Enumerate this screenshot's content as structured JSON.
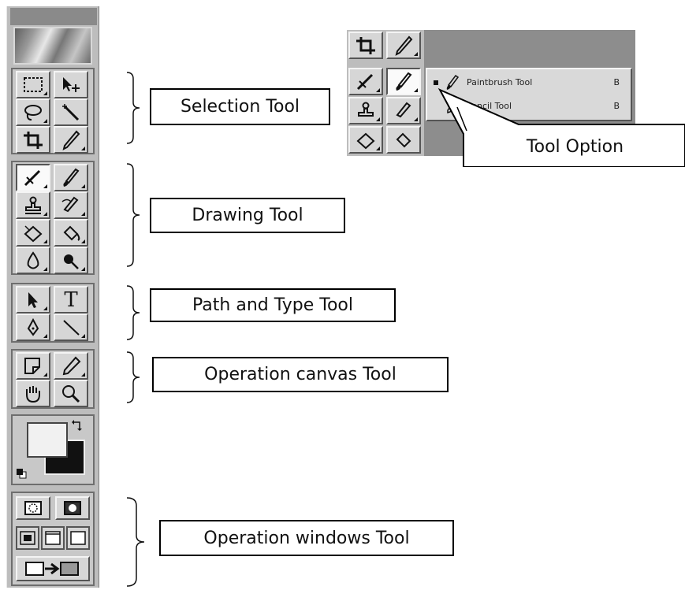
{
  "labels": {
    "selection": "Selection Tool",
    "drawing": "Drawing Tool",
    "path_type": "Path and Type Tool",
    "operation_canvas": "Operation canvas Tool",
    "operation_windows": "Operation windows Tool",
    "tool_option": "Tool Option"
  },
  "flyout": {
    "items": [
      {
        "label": "Paintbrush Tool",
        "shortcut": "B"
      },
      {
        "label": "Pencil Tool",
        "shortcut": "B"
      }
    ]
  },
  "tools": {
    "type_tool_glyph": "T"
  }
}
